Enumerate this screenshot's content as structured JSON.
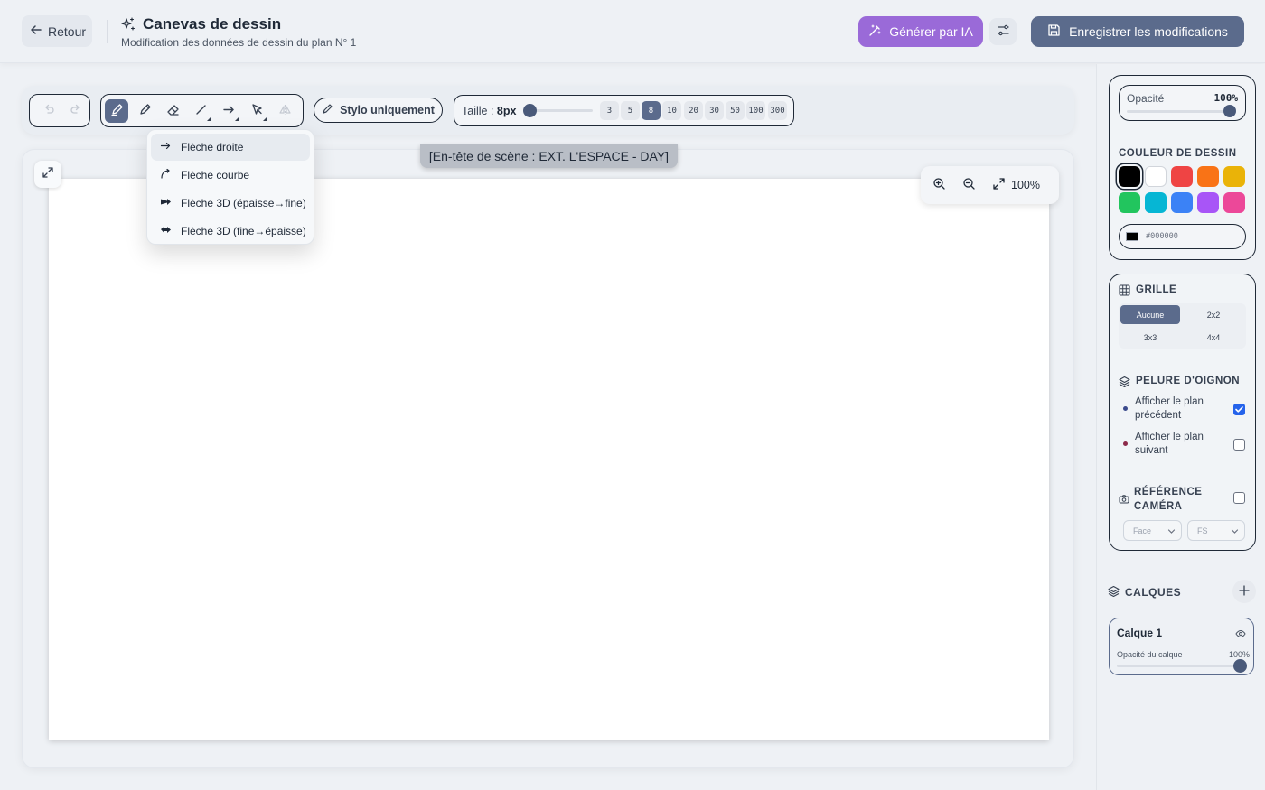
{
  "header": {
    "back_label": "Retour",
    "title": "Canevas de dessin",
    "subtitle": "Modification des données de dessin du plan N° 1",
    "ai_button": "Générer par IA",
    "save_button": "Enregistrer les modifications"
  },
  "toolbar": {
    "tools": [
      "pencil-icon",
      "pencil-alt-icon",
      "eraser-icon",
      "line-icon",
      "arrow-icon",
      "select-icon",
      "flip-icon"
    ],
    "active_tool": "pencil-icon",
    "pen_only_label": "Stylo uniquement",
    "size_label": "Taille : ",
    "size_value": "8px",
    "sizes": [
      "3",
      "5",
      "8",
      "10",
      "20",
      "30",
      "50",
      "100",
      "300"
    ],
    "active_size": "8"
  },
  "arrow_menu": {
    "items": [
      {
        "label": "Flèche droite",
        "icon": "arrow-right-icon"
      },
      {
        "label": "Flèche courbe",
        "icon": "curved-arrow-icon"
      },
      {
        "label": "Flèche 3D (épaisse→fine)",
        "icon": "arrow-3d-thick-thin-icon"
      },
      {
        "label": "Flèche 3D (fine→épaisse)",
        "icon": "arrow-3d-thin-thick-icon"
      }
    ],
    "active_index": 0
  },
  "canvas": {
    "scene_header": "[En-tête de scène : EXT. L'ESPACE - DAY]",
    "zoom": "100%"
  },
  "panel": {
    "opacity_label": "Opacité",
    "opacity_value": "100%",
    "color_section": "COULEUR DE DESSIN",
    "swatches": [
      "#000000",
      "#ffffff",
      "#ef4444",
      "#f97316",
      "#eab308",
      "#22c55e",
      "#06b6d4",
      "#3b82f6",
      "#a855f7",
      "#ec4899"
    ],
    "selected_color": "#000000",
    "hex_value": "#000000",
    "grid_section": "GRILLE",
    "grid_options": [
      "Aucune",
      "2x2",
      "3x3",
      "4x4"
    ],
    "grid_active": "Aucune",
    "onion_section": "PELURE D'OIGNON",
    "onion_prev": "Afficher le plan précédent",
    "onion_prev_checked": true,
    "onion_next": "Afficher le plan suivant",
    "onion_next_checked": false,
    "camera_section": "RÉFÉRENCE CAMÉRA",
    "camera_checked": false,
    "camera_select_1": "Face",
    "camera_select_2": "FS",
    "layers_section": "CALQUES",
    "layer_name": "Calque 1",
    "layer_opacity_label": "Opacité du calque",
    "layer_opacity_value": "100%"
  },
  "colors": {
    "accent": "#5b6b8c",
    "ai": "#9a6ad8",
    "checkbox": "#2563eb"
  }
}
